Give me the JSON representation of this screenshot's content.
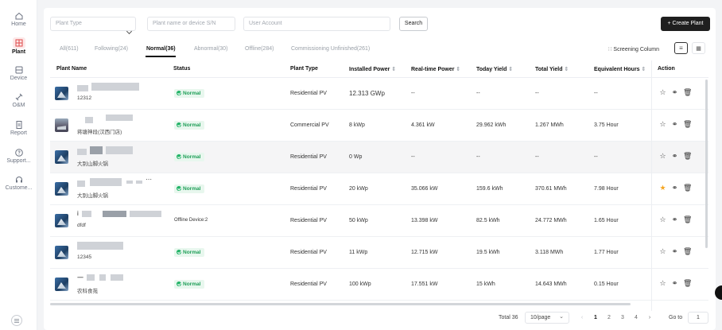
{
  "sidebar": {
    "items": [
      {
        "label": "Home",
        "icon": "home-icon"
      },
      {
        "label": "Plant",
        "icon": "plant-icon",
        "active": true
      },
      {
        "label": "Device",
        "icon": "device-icon"
      },
      {
        "label": "O&M",
        "icon": "tools-icon"
      },
      {
        "label": "Report",
        "icon": "report-icon"
      },
      {
        "label": "Support...",
        "icon": "help-icon"
      },
      {
        "label": "Custome...",
        "icon": "headset-icon"
      }
    ]
  },
  "filters": {
    "plant_type_placeholder": "Plant Type",
    "plant_name_placeholder": "Plant name or device S/N",
    "user_account_placeholder": "User Account",
    "search_label": "Search",
    "create_label": "+ Create Plant"
  },
  "tabs": [
    {
      "label": "All(611)"
    },
    {
      "label": "Following(24)"
    },
    {
      "label": "Normal(36)",
      "active": true
    },
    {
      "label": "Abnormal(30)"
    },
    {
      "label": "Offline(284)"
    },
    {
      "label": "Commissioning Unfinished(261)"
    }
  ],
  "screening_label": "Screening Column",
  "table": {
    "headers": [
      "Plant Name",
      "Status",
      "Plant Type",
      "Installed Power",
      "Real-time Power",
      "Today Yield",
      "Total Yield",
      "Equivalent Hours",
      "Action"
    ],
    "rows": [
      {
        "sub": "12312",
        "status": "Normal",
        "type": "Residential PV",
        "installed": "12.313 GWp",
        "realtime": "--",
        "today": "--",
        "total": "--",
        "hours": "--",
        "followed": false
      },
      {
        "sub": "蒋塘神段(汉西门店)",
        "status": "Normal",
        "type": "Commercial PV",
        "installed": "8 kWp",
        "realtime": "4.361 kW",
        "today": "29.962 kWh",
        "total": "1.267 MWh",
        "hours": "3.75 Hour",
        "followed": false
      },
      {
        "sub": "大别山脚火锅",
        "status": "Normal",
        "type": "Residential PV",
        "installed": "0 Wp",
        "realtime": "--",
        "today": "--",
        "total": "--",
        "hours": "--",
        "followed": false
      },
      {
        "sub": "大别山脚火锅",
        "status": "Normal",
        "type": "Residential PV",
        "installed": "20 kWp",
        "realtime": "35.066 kW",
        "today": "159.6 kWh",
        "total": "370.61 MWh",
        "hours": "7.98 Hour",
        "followed": true
      },
      {
        "sub": "dfdf",
        "status": "Offline Device:2",
        "type": "Residential PV",
        "installed": "50 kWp",
        "realtime": "13.398 kW",
        "today": "82.5 kWh",
        "total": "24.772 MWh",
        "hours": "1.65 Hour",
        "followed": false
      },
      {
        "sub": "12345",
        "status": "Normal",
        "type": "Residential PV",
        "installed": "11 kWp",
        "realtime": "12.715 kW",
        "today": "19.5 kWh",
        "total": "3.118 MWh",
        "hours": "1.77 Hour",
        "followed": false
      },
      {
        "sub": "农科食苑",
        "status": "Normal",
        "type": "Residential PV",
        "installed": "100 kWp",
        "realtime": "17.551 kW",
        "today": "15 kWh",
        "total": "14.643 MWh",
        "hours": "0.15 Hour",
        "followed": false
      }
    ]
  },
  "pagination": {
    "total": "Total 36",
    "page_size": "10/page",
    "pages": [
      "1",
      "2",
      "3",
      "4"
    ],
    "current": "1",
    "goto_label": "Go to",
    "goto_value": "1"
  },
  "colors": {
    "accent": "#e04a4a",
    "status_green": "#1fb265",
    "star_active": "#f5a623",
    "primary_button": "#1f1f1f"
  }
}
